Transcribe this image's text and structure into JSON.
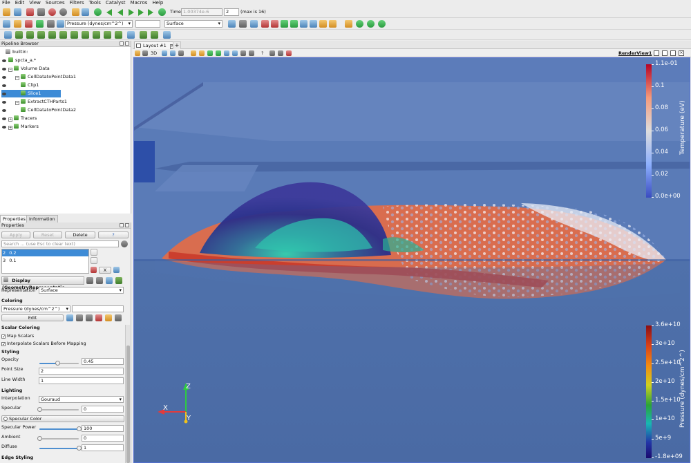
{
  "menu": [
    "File",
    "Edit",
    "View",
    "Sources",
    "Filters",
    "Tools",
    "Catalyst",
    "Macros",
    "Help"
  ],
  "toolbar": {
    "time_label": "Time:",
    "time_value": "1.00374e-6",
    "timestep": "2",
    "max_label": "(max is 16)",
    "color_by": "Pressure (dynes/cm^2^)",
    "representation": "Surface"
  },
  "pipeline": {
    "title": "Pipeline Browser",
    "items": [
      {
        "label": "builtin:"
      },
      {
        "label": "spcta_a.*"
      },
      {
        "label": "Volume Data"
      },
      {
        "label": "CellDatatoPointData1"
      },
      {
        "label": "Clip1"
      },
      {
        "label": "Slice1"
      },
      {
        "label": "ExtractCTHParts1"
      },
      {
        "label": "CellDatatoPointData2"
      },
      {
        "label": "Tracers"
      },
      {
        "label": "Markers"
      }
    ]
  },
  "tabs": {
    "properties": "Properties",
    "information": "Information"
  },
  "properties": {
    "title": "Properties",
    "apply": "Apply",
    "reset": "Reset",
    "delete": "Delete",
    "help": "?",
    "search_placeholder": "Search ... (use Esc to clear text)",
    "values": [
      {
        "index": "2",
        "value": "0.2"
      },
      {
        "index": "3",
        "value": "0.1"
      }
    ],
    "x_button": "X",
    "display_header": "Display (GeometryRepresentatic",
    "representation_label": "Representation",
    "representation_value": "Surface",
    "coloring_section": "Coloring",
    "coloring_value": "Pressure (dynes/cm^2^)",
    "edit_button": "Edit",
    "scalar_coloring_section": "Scalar Coloring",
    "map_scalars": "Map Scalars",
    "interpolate_scalars": "Interpolate Scalars Before Mapping",
    "styling_section": "Styling",
    "opacity_label": "Opacity",
    "opacity_value": "0.45",
    "opacity_level": 0.45,
    "point_size_label": "Point Size",
    "point_size_value": "2",
    "line_width_label": "Line Width",
    "line_width_value": "1",
    "lighting_section": "Lighting",
    "interpolation_label": "Interpolation",
    "interpolation_value": "Gouraud",
    "specular_label": "Specular",
    "specular_value": "0",
    "specular_level": 0,
    "specular_color": "Specular Color",
    "specular_power_label": "Specular Power",
    "specular_power_value": "100",
    "specular_power_level": 1.0,
    "ambient_label": "Ambient",
    "ambient_value": "0",
    "ambient_level": 0,
    "diffuse_label": "Diffuse",
    "diffuse_value": "1",
    "diffuse_level": 1.0,
    "edge_styling_section": "Edge Styling"
  },
  "layout": {
    "tab_label": "Layout #1",
    "add_tab": "+",
    "view_name": "RenderView1",
    "mode_3d": "3D",
    "query": "?"
  },
  "colorbars": {
    "temperature": {
      "title": "Temperature (eV)",
      "ticks": [
        "1.1e-01",
        "0.1",
        "0.08",
        "0.06",
        "0.04",
        "0.02",
        "0.0e+00"
      ]
    },
    "pressure": {
      "title": "Pressure (dynes/cm^2^)",
      "ticks": [
        "3.6e+10",
        "3e+10",
        "2.5e+10",
        "2e+10",
        "1.5e+10",
        "1e+10",
        "5e+9",
        "-1.8e+09"
      ]
    }
  },
  "axes": {
    "x": "X",
    "y": "Y",
    "z": "Z"
  },
  "colors": {
    "background": "#4c6faa",
    "selection": "#3d8bd6",
    "accent": "#5470cf"
  }
}
